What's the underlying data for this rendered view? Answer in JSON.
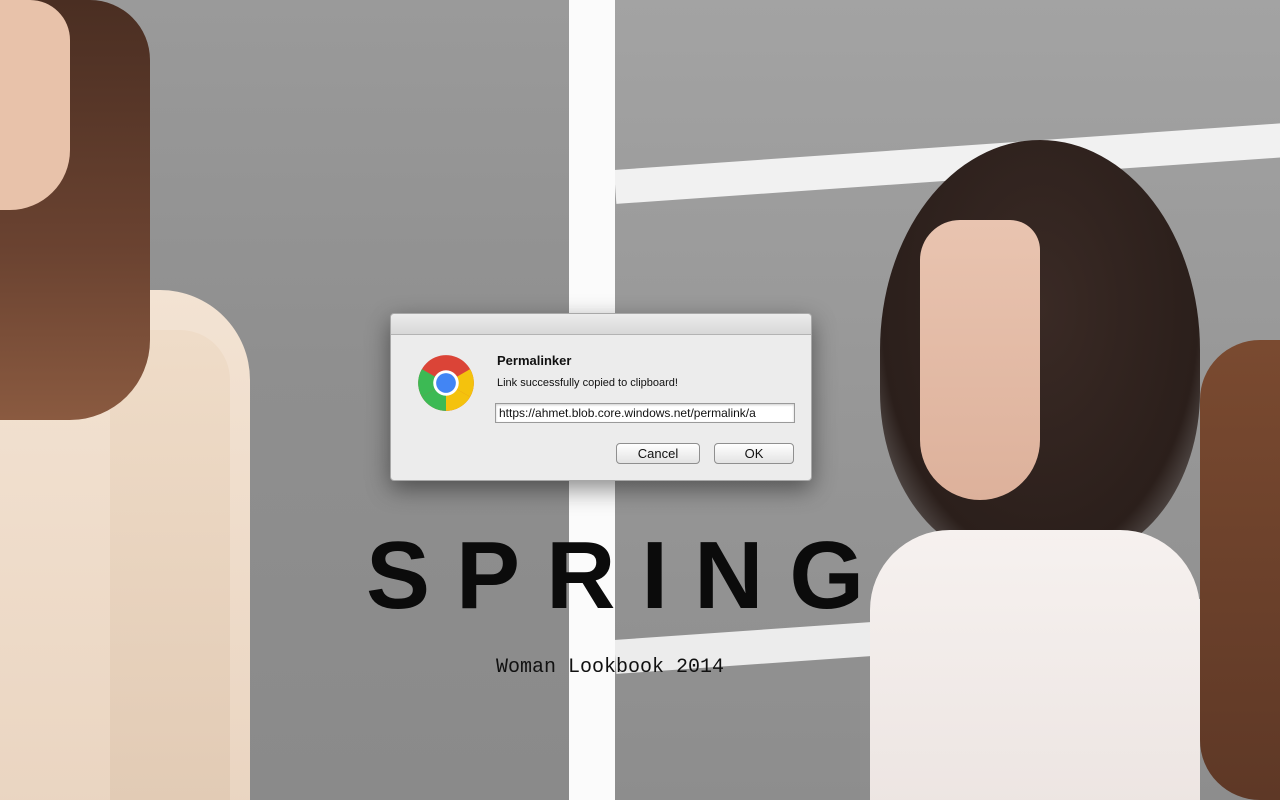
{
  "background": {
    "headline": "SPRING",
    "subheadline": "Woman Lookbook 2014"
  },
  "dialog": {
    "icon": "chrome-icon",
    "title": "Permalinker",
    "message": "Link successfully copied to clipboard!",
    "url_value": "https://ahmet.blob.core.windows.net/permalink/a",
    "cancel_label": "Cancel",
    "ok_label": "OK"
  },
  "colors": {
    "chrome_red": "#db4437",
    "chrome_yellow": "#f4c20d",
    "chrome_green": "#3cba54",
    "chrome_blue": "#4285f4",
    "dialog_bg": "#ececec"
  }
}
